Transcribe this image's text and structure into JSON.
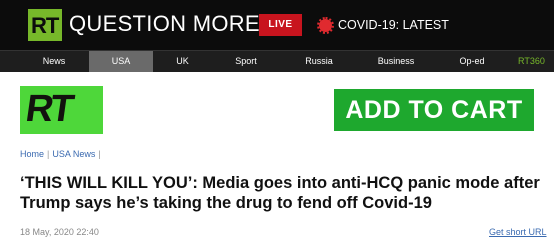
{
  "header": {
    "logo_text": "RT",
    "brand_title": "QUESTION MORE",
    "live_label": "LIVE",
    "covid_label": "COVID-19: LATEST",
    "logo_color": "#77b82a",
    "live_color": "#c8141e"
  },
  "nav": {
    "items": [
      {
        "label": "News"
      },
      {
        "label": "USA",
        "active": true
      },
      {
        "label": "UK"
      },
      {
        "label": "Sport"
      },
      {
        "label": "Russia"
      },
      {
        "label": "Business"
      },
      {
        "label": "Op-ed"
      },
      {
        "label": "RT360"
      }
    ]
  },
  "ad": {
    "logo_text": "RT",
    "cta_label": "ADD TO CART",
    "brand_green": "#4ed73a",
    "cta_green": "#1ea82e"
  },
  "breadcrumb": {
    "home": "Home",
    "separator": "|",
    "section": "USA News",
    "trail_end": "|"
  },
  "article": {
    "headline": "‘THIS WILL KILL YOU’: Media goes into anti-HCQ panic mode after Trump says he’s taking the drug to fend off Covid-19",
    "timestamp": "18 May, 2020 22:40",
    "short_url_label": "Get short URL"
  }
}
